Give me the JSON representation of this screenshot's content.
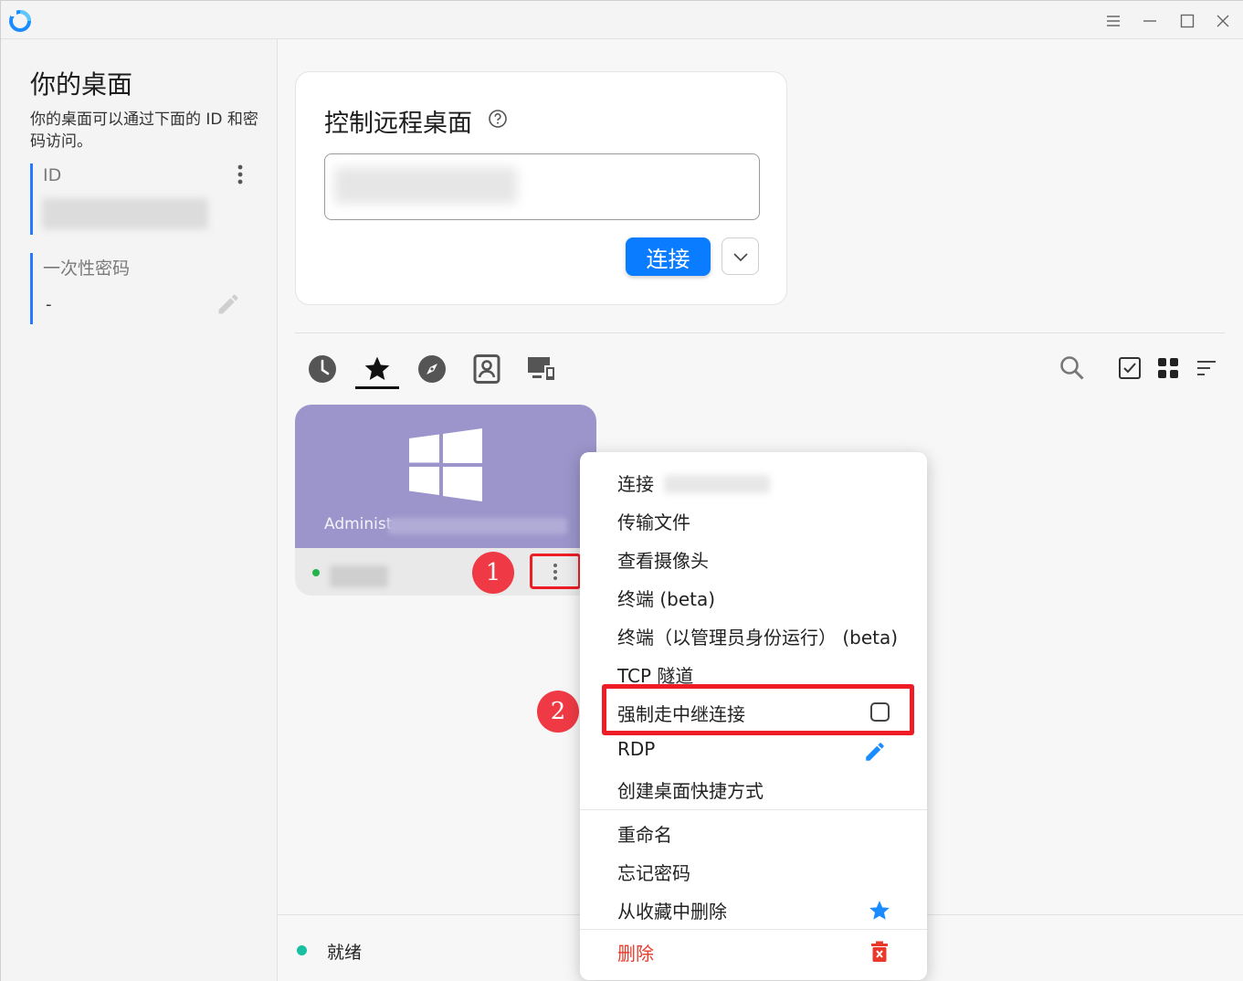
{
  "window": {
    "controls": {
      "menu_icon": "hamburger-icon",
      "minimize_icon": "minimize-icon",
      "maximize_icon": "maximize-icon",
      "close_icon": "close-icon"
    }
  },
  "left": {
    "title": "你的桌面",
    "description": "你的桌面可以通过下面的 ID 和密码访问。",
    "id_label": "ID",
    "password_label": "一次性密码",
    "password_value": "-"
  },
  "connect": {
    "title": "控制远程桌面",
    "connect_label": "连接"
  },
  "tabs": [
    {
      "name": "recent",
      "icon": "clock-icon"
    },
    {
      "name": "favorites",
      "icon": "star-icon",
      "active": true
    },
    {
      "name": "discovered",
      "icon": "compass-icon"
    },
    {
      "name": "address-book",
      "icon": "contacts-icon"
    },
    {
      "name": "group",
      "icon": "devices-icon"
    }
  ],
  "peer": {
    "name_prefix": "Administ",
    "name_suffix": "ı",
    "badge1": "1",
    "badge2": "2"
  },
  "status": {
    "text": "就绪",
    "color": "#16c0a0"
  },
  "menu": {
    "items": [
      "连接",
      "传输文件",
      "查看摄像头",
      "终端 (beta)",
      "终端（以管理员身份运行） (beta)",
      "TCP 隧道",
      "强制走中继连接",
      "RDP",
      "创建桌面快捷方式",
      "重命名",
      "忘记密码",
      "从收藏中删除",
      "删除"
    ]
  },
  "colors": {
    "accent": "#0a7cff",
    "highlight": "#ee1c25",
    "peer_card": "#9b95cb",
    "delete": "#e8392b"
  }
}
